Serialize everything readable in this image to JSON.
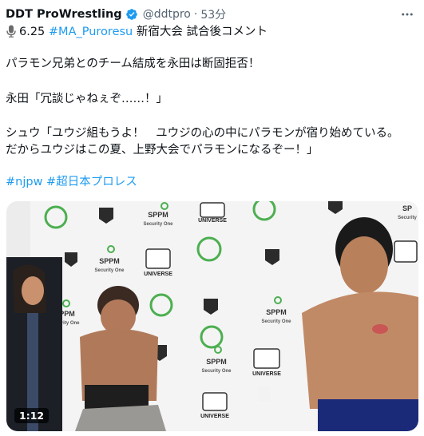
{
  "author": {
    "name": "DDT ProWrestling",
    "handle": "@ddtpro",
    "separator": "·",
    "time": "53分",
    "verified_color": "#1d9bf0"
  },
  "tweet": {
    "line1_prefix": "6.25 ",
    "line1_hashtag": "#MA_Puroresu",
    "line1_suffix": " 新宿大会 試合後コメント",
    "line2": "パラモン兄弟とのチーム結成を永田は断固拒否！",
    "line3": "永田「冗談じゃねぇぞ……！」",
    "line4": "シュウ「ユウジ組もうよ！　ユウジの心の中にパラモンが宿り始めている。",
    "line5": "だからユウジはこの夏、上野大会でパラモンになるぞー！」",
    "hashtag1": "#njpw",
    "hashtag2": "#超日本プロレス"
  },
  "media": {
    "duration": "1:12",
    "sponsor_sppm": "SPPM",
    "sponsor_sub": "Security One",
    "sponsor_universe": "UNIVERSE",
    "sponsor_sppm_short": "SP",
    "sponsor_sub_short": "Security"
  },
  "colors": {
    "link": "#1d9bf0",
    "text": "#0f1419",
    "muted": "#536471"
  }
}
